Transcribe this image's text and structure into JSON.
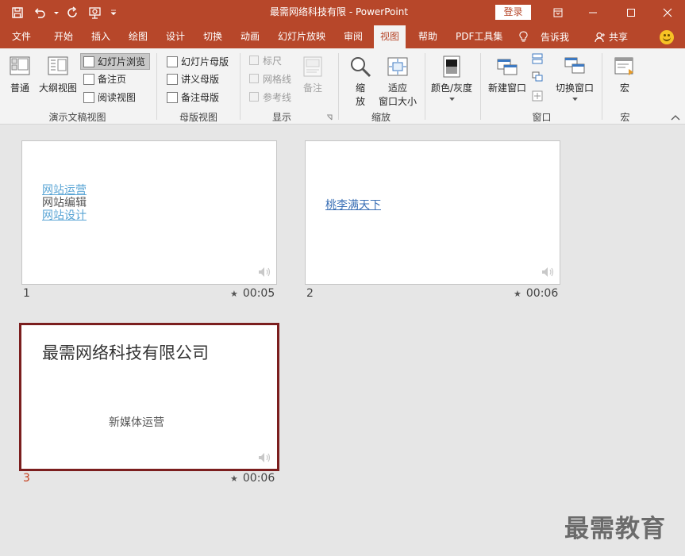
{
  "window": {
    "title": "最需网络科技有限 - PowerPoint",
    "login_label": "登录"
  },
  "tabs": [
    {
      "label": "文件"
    },
    {
      "label": "开始"
    },
    {
      "label": "插入"
    },
    {
      "label": "绘图"
    },
    {
      "label": "设计"
    },
    {
      "label": "切换"
    },
    {
      "label": "动画"
    },
    {
      "label": "幻灯片放映"
    },
    {
      "label": "审阅"
    },
    {
      "label": "视图"
    },
    {
      "label": "帮助"
    },
    {
      "label": "PDF工具集"
    }
  ],
  "tell_me": "告诉我",
  "share": "共享",
  "ribbon": {
    "presentation_views": {
      "label": "演示文稿视图",
      "normal": "普通",
      "outline": "大纲视图",
      "slide_sorter": "幻灯片浏览",
      "notes_page": "备注页",
      "reading_view": "阅读视图"
    },
    "master_views": {
      "label": "母版视图",
      "slide_master": "幻灯片母版",
      "handout_master": "讲义母版",
      "notes_master": "备注母版"
    },
    "show": {
      "label": "显示",
      "ruler": "标尺",
      "gridlines": "网格线",
      "guides": "参考线",
      "notes": "备注"
    },
    "zoom": {
      "label": "缩放",
      "zoom_line1": "缩",
      "zoom_line2": "放",
      "fit_line1": "适应",
      "fit_line2": "窗口大小"
    },
    "color": {
      "label": "颜色/灰度"
    },
    "window": {
      "label": "窗口",
      "new_window": "新建窗口",
      "switch_windows": "切换窗口"
    },
    "macros": {
      "label": "宏",
      "macro": "宏"
    }
  },
  "slides": [
    {
      "number": "1",
      "time": "00:05",
      "lines": [
        "网站运营",
        "网站编辑",
        "网站设计"
      ]
    },
    {
      "number": "2",
      "time": "00:06",
      "link": "桃李满天下"
    },
    {
      "number": "3",
      "time": "00:06",
      "title": "最需网络科技有限公司",
      "subtitle": "新媒体运营"
    }
  ],
  "watermark": "最需教育",
  "colors": {
    "accent": "#b7472a",
    "selected_border": "#7b1e1e",
    "link": "#5aa5d5"
  }
}
